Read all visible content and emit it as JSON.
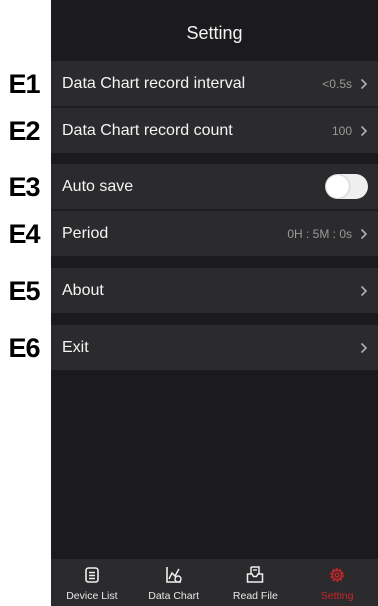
{
  "callouts": [
    "E1",
    "E2",
    "E3",
    "E4",
    "E5",
    "E6"
  ],
  "header": {
    "title": "Setting"
  },
  "settings": {
    "record_interval": {
      "label": "Data Chart record interval",
      "value": "<0.5s"
    },
    "record_count": {
      "label": "Data Chart record count",
      "value": "100"
    },
    "auto_save": {
      "label": "Auto save",
      "enabled": false
    },
    "period": {
      "label": "Period",
      "value": "0H : 5M : 0s"
    },
    "about": {
      "label": "About"
    },
    "exit": {
      "label": "Exit"
    }
  },
  "tabbar": {
    "tabs": [
      {
        "label": "Device List",
        "icon": "device-list-icon",
        "active": false
      },
      {
        "label": "Data Chart",
        "icon": "data-chart-icon",
        "active": false
      },
      {
        "label": "Read File",
        "icon": "read-file-icon",
        "active": false
      },
      {
        "label": "Setting",
        "icon": "gear-icon",
        "active": true
      }
    ]
  },
  "colors": {
    "accent": "#c8262a",
    "background": "#1b1b1d",
    "row": "#2b2b2d"
  }
}
